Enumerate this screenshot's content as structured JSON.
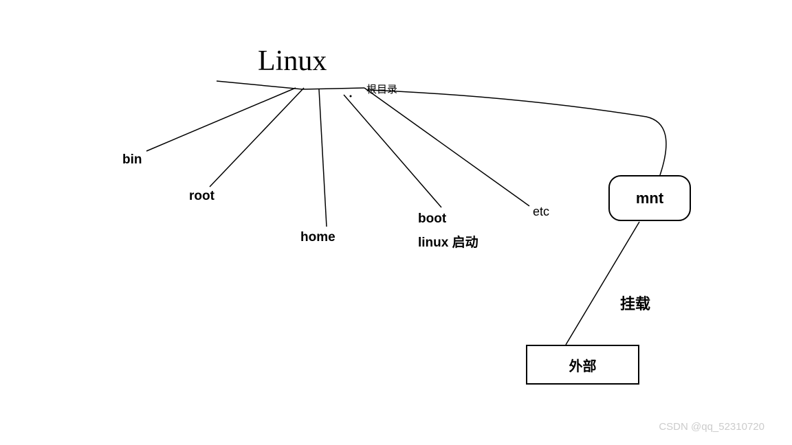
{
  "title": "Linux",
  "root_label": "根目录",
  "directories": {
    "bin": "bin",
    "root": "root",
    "home": "home",
    "boot": "boot",
    "boot_sub": "linux 启动",
    "etc": "etc",
    "mnt": "mnt"
  },
  "mount_label": "挂载",
  "external": "外部",
  "watermark": "CSDN @qq_52310720"
}
